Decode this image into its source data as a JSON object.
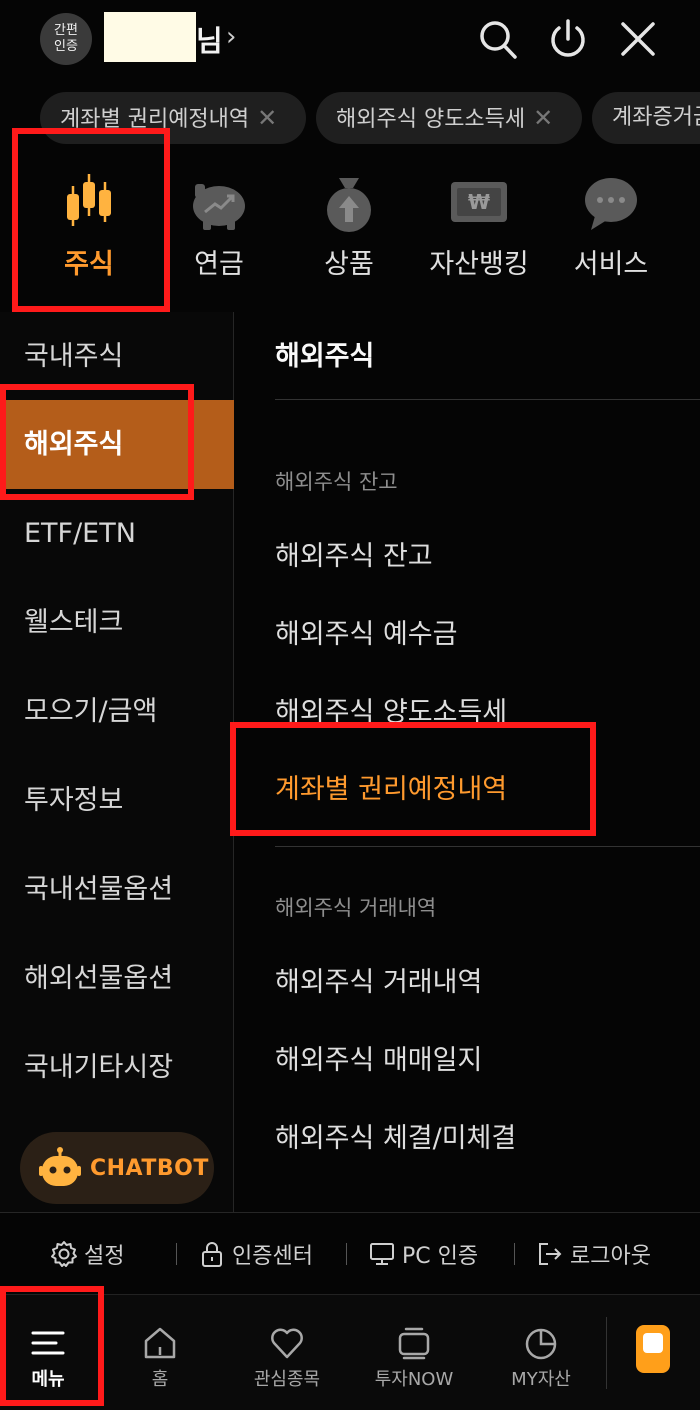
{
  "header": {
    "auth_badge": "간편\n인증",
    "user_suffix": "님",
    "user_chevron": "›"
  },
  "recent_chips": [
    {
      "label": "계좌별 권리예정내역",
      "close": "✕"
    },
    {
      "label": "해외주식 양도소득세",
      "close": "✕"
    },
    {
      "label": "계좌증거금",
      "close": ""
    }
  ],
  "categories": [
    {
      "label": "주식",
      "icon": "candlestick-icon",
      "active": true
    },
    {
      "label": "연금",
      "icon": "piggy-bank-icon",
      "active": false
    },
    {
      "label": "상품",
      "icon": "money-bag-icon",
      "active": false
    },
    {
      "label": "자산뱅킹",
      "icon": "won-card-icon",
      "active": false
    },
    {
      "label": "서비스",
      "icon": "chat-bubble-icon",
      "active": false
    }
  ],
  "left_menu": [
    {
      "label": "국내주식",
      "active": false
    },
    {
      "label": "해외주식",
      "active": true
    },
    {
      "label": "ETF/ETN",
      "active": false
    },
    {
      "label": "웰스테크",
      "active": false
    },
    {
      "label": "모으기/금액",
      "active": false
    },
    {
      "label": "투자정보",
      "active": false
    },
    {
      "label": "국내선물옵션",
      "active": false
    },
    {
      "label": "해외선물옵션",
      "active": false
    },
    {
      "label": "국내기타시장",
      "active": false
    }
  ],
  "chatbot": {
    "label": "CHATBOT"
  },
  "right_panel": {
    "title": "해외주식",
    "sections": [
      {
        "heading": "해외주식 잔고",
        "items": [
          {
            "label": "해외주식 잔고",
            "active": false
          },
          {
            "label": "해외주식 예수금",
            "active": false
          },
          {
            "label": "해외주식 양도소득세",
            "active": false
          },
          {
            "label": "계좌별 권리예정내역",
            "active": true
          }
        ]
      },
      {
        "heading": "해외주식 거래내역",
        "items": [
          {
            "label": "해외주식 거래내역",
            "active": false
          },
          {
            "label": "해외주식 매매일지",
            "active": false
          },
          {
            "label": "해외주식 체결/미체결",
            "active": false
          }
        ]
      }
    ]
  },
  "utilities": [
    {
      "label": "설정",
      "icon": "gear-icon"
    },
    {
      "label": "인증센터",
      "icon": "lock-icon"
    },
    {
      "label": "PC 인증",
      "icon": "monitor-icon"
    },
    {
      "label": "로그아웃",
      "icon": "logout-icon"
    }
  ],
  "bottom_nav": [
    {
      "label": "메뉴",
      "icon": "menu-icon",
      "active": true
    },
    {
      "label": "홈",
      "icon": "home-icon",
      "active": false
    },
    {
      "label": "관심종목",
      "icon": "heart-icon",
      "active": false
    },
    {
      "label": "투자NOW",
      "icon": "tv-icon",
      "active": false
    },
    {
      "label": "MY자산",
      "icon": "pie-chart-icon",
      "active": false
    }
  ],
  "colors": {
    "accent": "#ff9a2e",
    "active_bg": "#b45d1a",
    "highlight": "#ff1a1a",
    "background": "#050505"
  }
}
